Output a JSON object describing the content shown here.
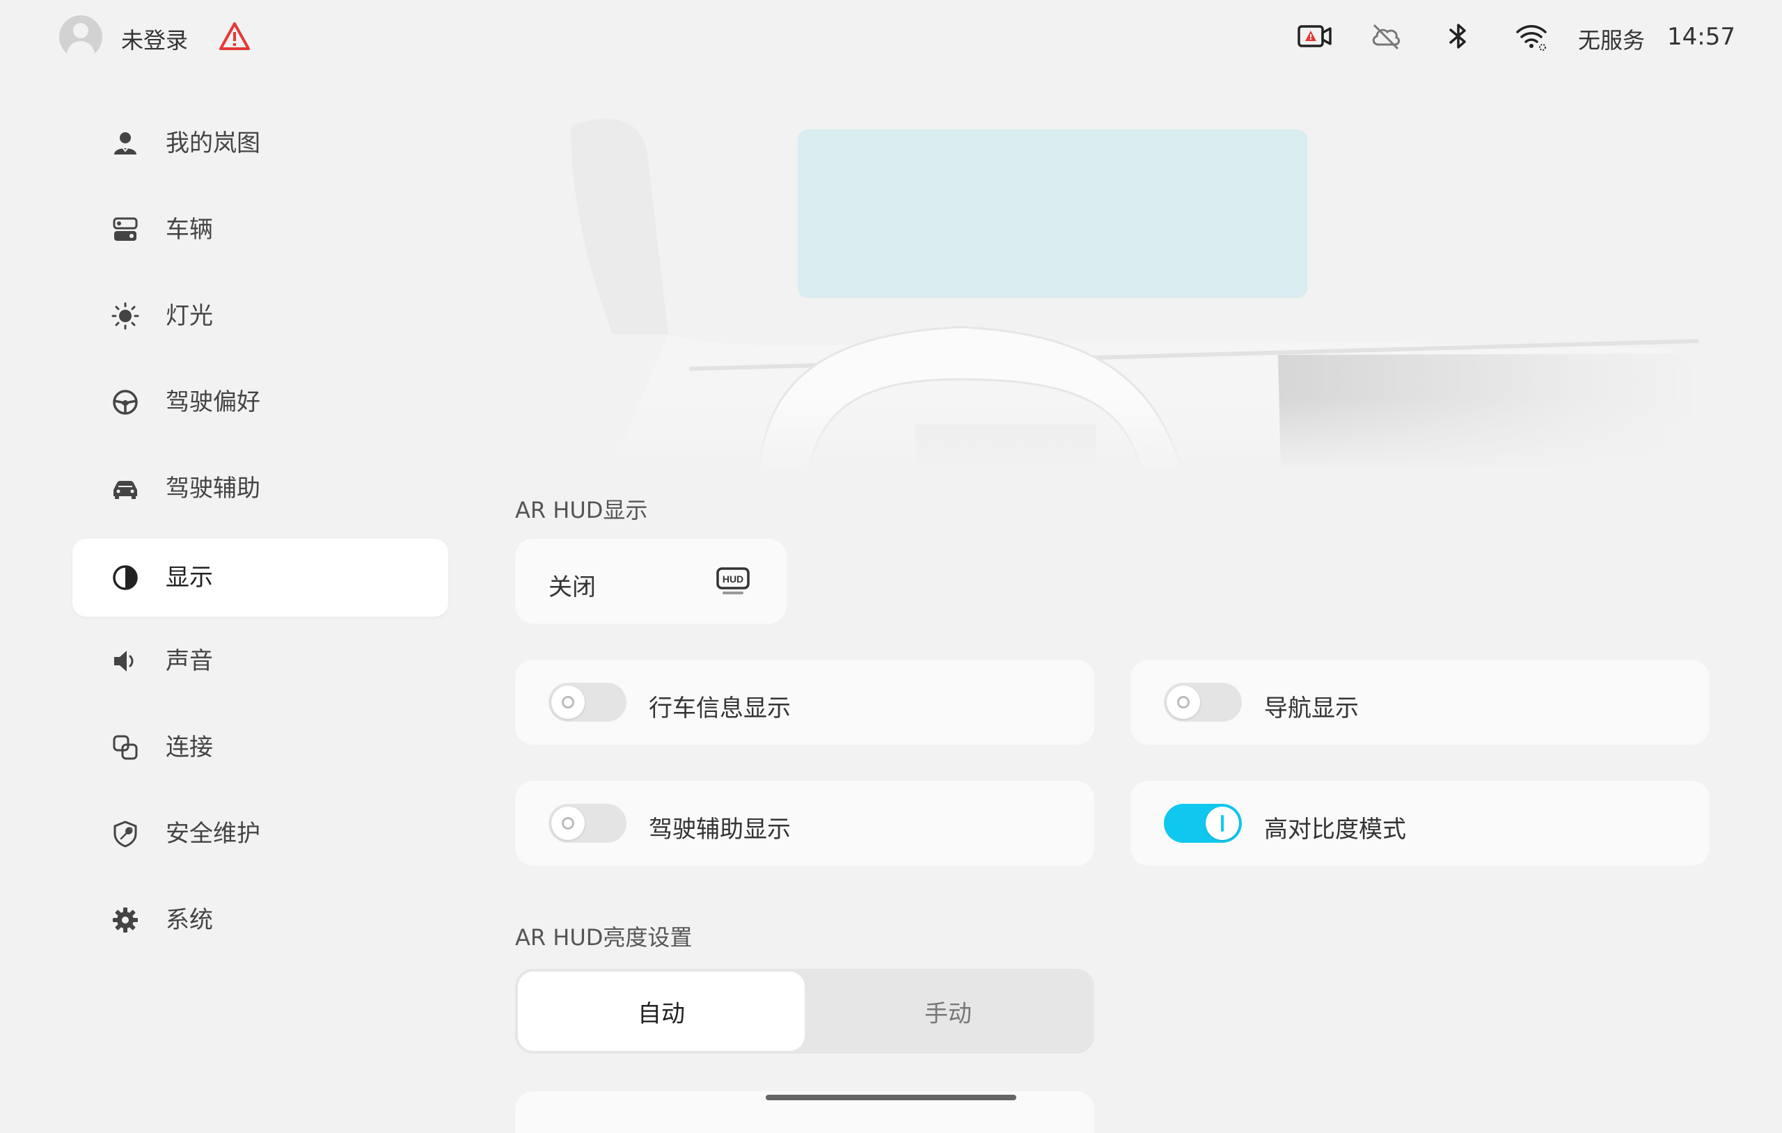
{
  "status_bar": {
    "login_label": "未登录",
    "network_label": "无服务",
    "time": "14:57",
    "icons": [
      "avatar-icon",
      "warning-icon",
      "dashcam-warning-icon",
      "cloud-off-icon",
      "bluetooth-icon",
      "wifi-icon"
    ],
    "warning_color": "#e53935"
  },
  "sidebar": {
    "items": [
      {
        "label": "我的岚图",
        "icon": "user-icon"
      },
      {
        "label": "车辆",
        "icon": "vehicle-controls-icon"
      },
      {
        "label": "灯光",
        "icon": "light-icon"
      },
      {
        "label": "驾驶偏好",
        "icon": "steering-wheel-icon"
      },
      {
        "label": "驾驶辅助",
        "icon": "car-assist-icon"
      },
      {
        "label": "显示",
        "icon": "display-contrast-icon",
        "active": true
      },
      {
        "label": "声音",
        "icon": "speaker-icon"
      },
      {
        "label": "连接",
        "icon": "connection-icon"
      },
      {
        "label": "安全维护",
        "icon": "shield-wrench-icon"
      },
      {
        "label": "系统",
        "icon": "gear-icon"
      }
    ]
  },
  "hud_section": {
    "title": "AR HUD显示",
    "mode_label": "关闭",
    "mode_icon": "hud-icon"
  },
  "toggles": {
    "driving_info": {
      "label": "行车信息显示",
      "on": false
    },
    "navigation": {
      "label": "导航显示",
      "on": false
    },
    "driving_assist": {
      "label": "驾驶辅助显示",
      "on": false
    },
    "high_contrast": {
      "label": "高对比度模式",
      "on": true
    }
  },
  "brightness_section": {
    "title": "AR HUD亮度设置",
    "options": [
      "自动",
      "手动"
    ],
    "selected": "自动"
  },
  "colors": {
    "accent": "#10c8ef",
    "background": "#f2f2f2",
    "card": "#fafafa",
    "hud_projection": "#d9ecf0"
  }
}
